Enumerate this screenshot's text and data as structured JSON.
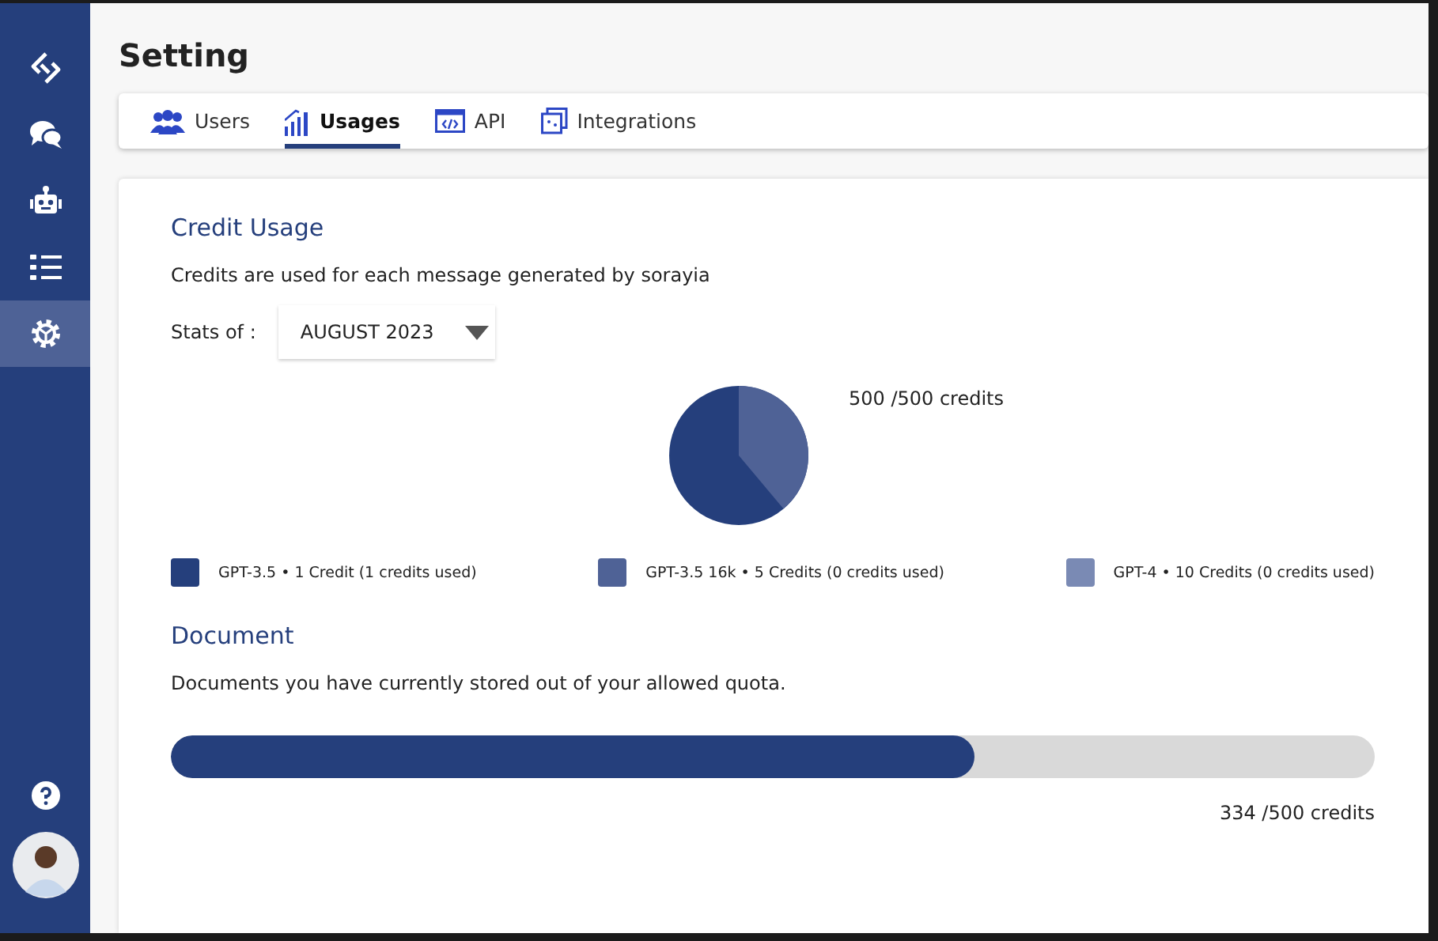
{
  "sidebar": {
    "items": [
      {
        "kind": "logo",
        "selected": false
      },
      {
        "kind": "chat",
        "selected": false
      },
      {
        "kind": "bot",
        "selected": false
      },
      {
        "kind": "list",
        "selected": false
      },
      {
        "kind": "settings",
        "selected": true
      }
    ]
  },
  "header": {
    "title": "Setting"
  },
  "tabs": [
    {
      "kind": "users",
      "label": "Users",
      "selected": false
    },
    {
      "kind": "usages",
      "label": "Usages",
      "selected": true
    },
    {
      "kind": "api",
      "label": "API",
      "selected": false
    },
    {
      "kind": "integrations",
      "label": "Integrations",
      "selected": false
    }
  ],
  "credit_usage": {
    "title": "Credit Usage",
    "description": "Credits are used for each message generated by sorayia",
    "stats_label": "Stats of :",
    "month": "AUGUST 2023",
    "total": "500 /500 credits",
    "legend": [
      {
        "label": "GPT-3.5 • 1 Credit (1 credits used)",
        "color": "#253f7c"
      },
      {
        "label": "GPT-3.5 16k • 5 Credits (0 credits used)",
        "color": "#4f6296"
      },
      {
        "label": "GPT-4 • 10 Credits (0 credits used)",
        "color": "#7a8ab4"
      }
    ]
  },
  "document": {
    "title": "Document",
    "description": "Documents you have currently stored out of your allowed quota.",
    "level": 0.667,
    "reading": "334 /500 credits"
  }
}
